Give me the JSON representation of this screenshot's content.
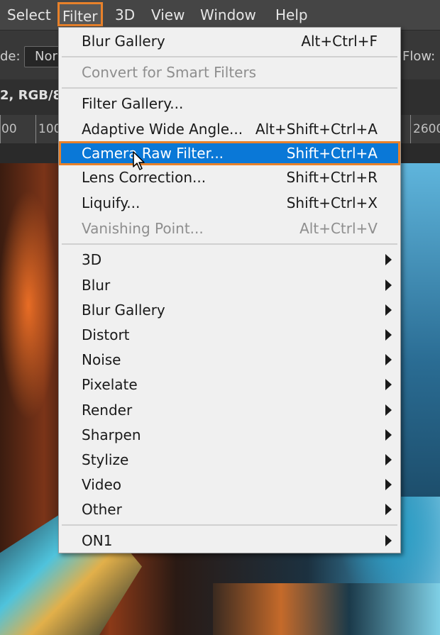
{
  "menubar": {
    "items": [
      "Select",
      "Filter",
      "3D",
      "View",
      "Window",
      "Help"
    ]
  },
  "options": {
    "mode_label_partial": "de:",
    "mode_value_partial": "Nor",
    "flow_label": "Flow:"
  },
  "document": {
    "tab_title_partial": "2, RGB/8)"
  },
  "ruler": {
    "labels": [
      "00",
      "100",
      "2600"
    ]
  },
  "filter_menu": {
    "blur_gallery_top": {
      "label": "Blur Gallery",
      "shortcut": "Alt+Ctrl+F"
    },
    "convert_smart": {
      "label": "Convert for Smart Filters"
    },
    "filter_gallery": {
      "label": "Filter Gallery..."
    },
    "adaptive_wide": {
      "label": "Adaptive Wide Angle...",
      "shortcut": "Alt+Shift+Ctrl+A"
    },
    "camera_raw": {
      "label": "Camera Raw Filter...",
      "shortcut": "Shift+Ctrl+A"
    },
    "lens_correction": {
      "label": "Lens Correction...",
      "shortcut": "Shift+Ctrl+R"
    },
    "liquify": {
      "label": "Liquify...",
      "shortcut": "Shift+Ctrl+X"
    },
    "vanishing_point": {
      "label": "Vanishing Point...",
      "shortcut": "Alt+Ctrl+V"
    },
    "submenus": [
      "3D",
      "Blur",
      "Blur Gallery",
      "Distort",
      "Noise",
      "Pixelate",
      "Render",
      "Sharpen",
      "Stylize",
      "Video",
      "Other"
    ],
    "plugins": [
      "ON1"
    ]
  },
  "colors": {
    "highlight": "#0a78d7",
    "accent_outline": "#e8812a",
    "menu_bg": "#f0f0f0",
    "menubar_bg": "#454545"
  }
}
